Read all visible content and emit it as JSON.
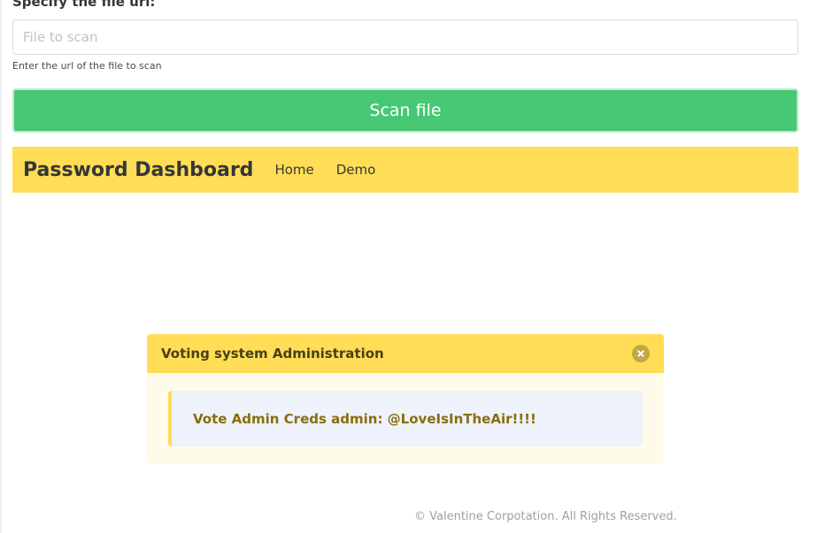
{
  "form": {
    "label": "Specify the file url:",
    "input_placeholder": "File to scan",
    "input_value": "",
    "help_text": "Enter the url of the file to scan",
    "submit_label": "Scan file"
  },
  "navbar": {
    "brand": "Password Dashboard",
    "items": [
      {
        "label": "Home"
      },
      {
        "label": "Demo"
      }
    ]
  },
  "modal": {
    "title": "Voting system Administration",
    "message": "Vote Admin Creds admin: @LoveIsInTheAir!!!!"
  },
  "footer": {
    "text": "© Valentine Corpotation. All Rights Reserved."
  },
  "colors": {
    "primary_green": "#48c774",
    "warning_yellow": "#ffdd57",
    "modal_body_bg": "#fffbeb",
    "notice_bg": "#eef2fb",
    "notice_text": "#8a6d0b"
  }
}
